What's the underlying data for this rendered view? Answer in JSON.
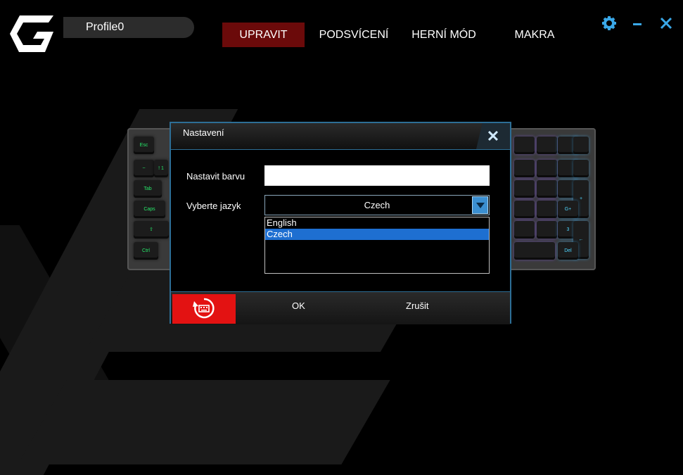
{
  "header": {
    "profile_name": "Profile0",
    "tabs": [
      "UPRAVIT",
      "PODSVÍCENÍ",
      "HERNÍ MÓD",
      "MAKRA"
    ],
    "active_tab": "UPRAVIT"
  },
  "keyboard": {
    "left_keys": [
      "Esc",
      "~",
      "! 1",
      "Tab",
      "Caps",
      "⇧",
      "Ctrl"
    ],
    "right_keys": [
      "+",
      "G+",
      "3",
      "←",
      "Del"
    ]
  },
  "dialog": {
    "title": "Nastavení",
    "color_label": "Nastavit barvu",
    "color_value": "",
    "language_label": "Vyberte jazyk",
    "language_selected": "Czech",
    "language_options": [
      "English",
      "Czech"
    ],
    "ok_label": "OK",
    "cancel_label": "Zrušit"
  },
  "colors": {
    "accent_red": "#6b0a0a",
    "reset_red": "#e31212",
    "border_blue": "#2d6e96",
    "select_blue": "#1e6fd1",
    "window_icon_blue": "#3aa8e8"
  }
}
